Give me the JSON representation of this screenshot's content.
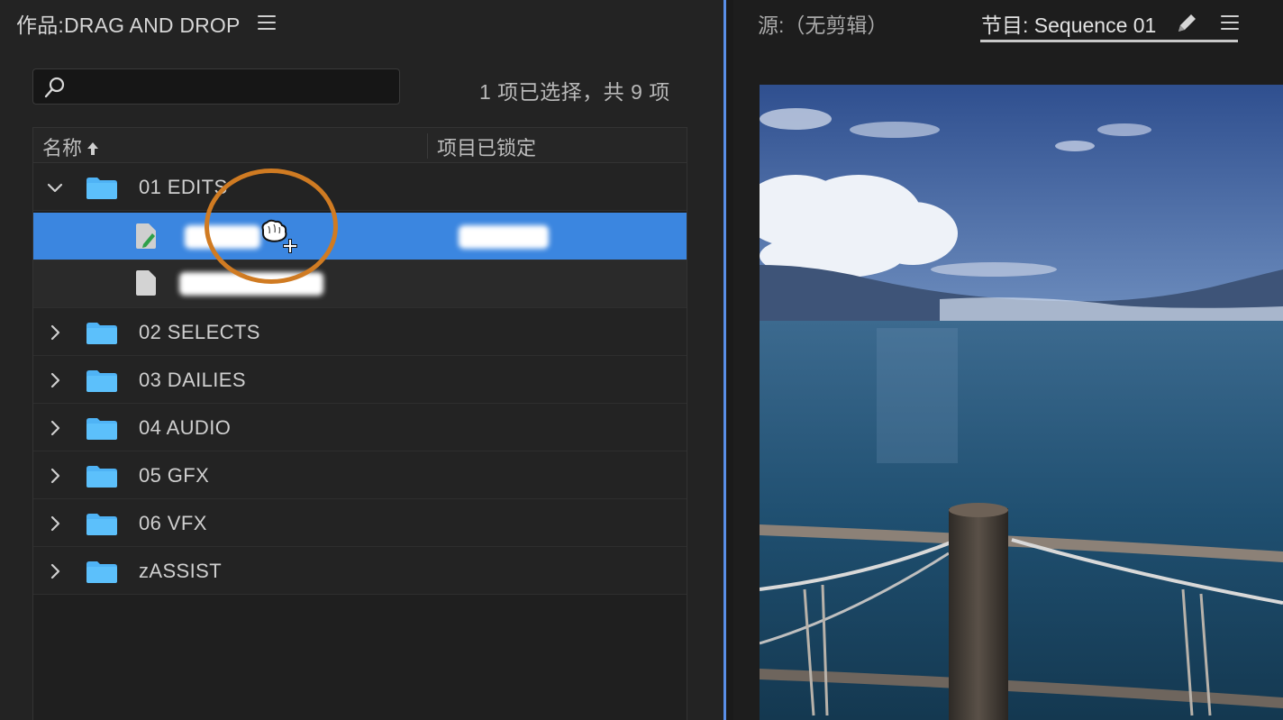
{
  "project_panel": {
    "title": "作品:DRAG AND DROP",
    "search": {
      "value": "",
      "placeholder": ""
    },
    "selection_count": "1 项已选择，共 9 项",
    "columns": {
      "name": "名称",
      "locked": "项目已锁定"
    },
    "folders": [
      {
        "label": "01 EDITS",
        "expanded": true
      },
      {
        "label": "02 SELECTS",
        "expanded": false
      },
      {
        "label": "03 DAILIES",
        "expanded": false
      },
      {
        "label": "04 AUDIO",
        "expanded": false
      },
      {
        "label": "05 GFX",
        "expanded": false
      },
      {
        "label": "06 VFX",
        "expanded": false
      },
      {
        "label": "zASSIST",
        "expanded": false
      }
    ],
    "edits_children": [
      {
        "type": "sequence",
        "selected": true,
        "name_redacted": true
      },
      {
        "type": "file",
        "selected": false,
        "name_redacted": true
      }
    ]
  },
  "monitor_panel": {
    "source_tab": "源:（无剪辑）",
    "program_tab": "节目: Sequence 01"
  },
  "colors": {
    "panel_bg": "#232323",
    "selection": "#3b86e0",
    "folder": "#4fb3f5",
    "highlight_ring": "#d07b22",
    "active_divider": "#5a8fe8"
  },
  "icons": [
    "search-icon",
    "sort-ascending-icon",
    "chevron-down-icon",
    "chevron-right-icon",
    "folder-icon",
    "sequence-icon",
    "file-icon",
    "grab-hand-cursor-icon",
    "pencil-icon",
    "hamburger-menu-icon"
  ]
}
